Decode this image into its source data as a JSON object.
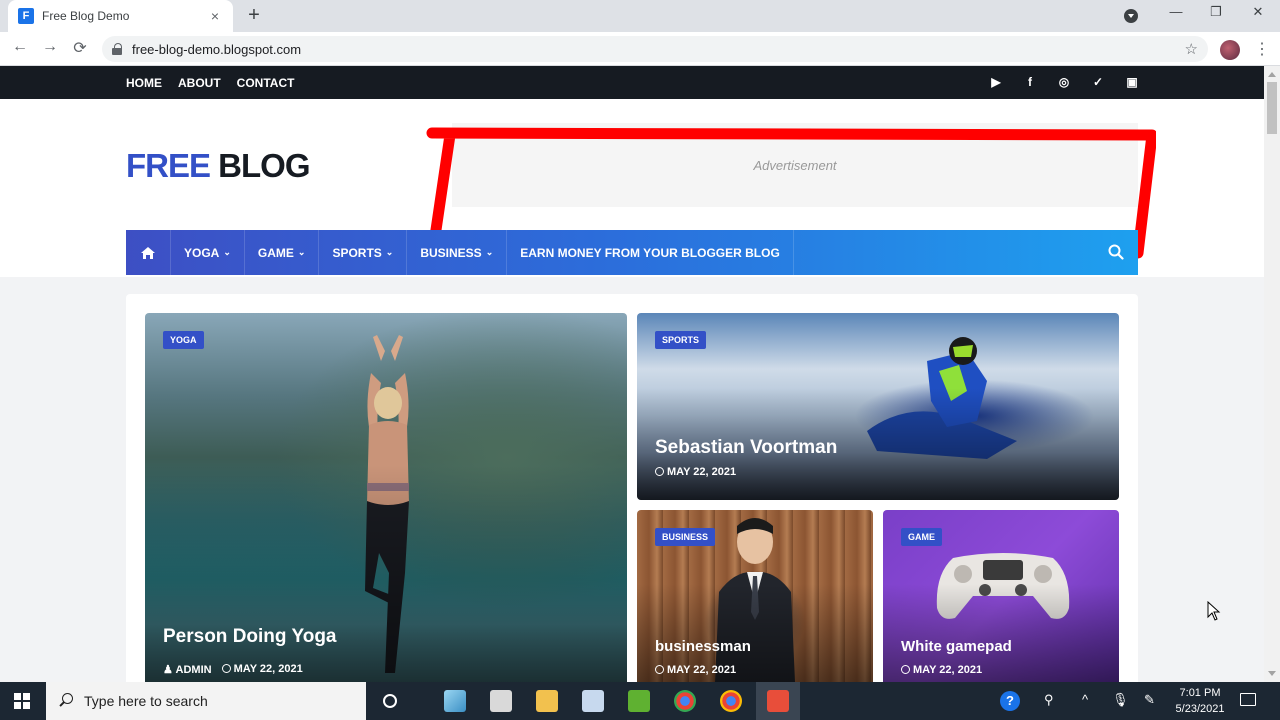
{
  "browser": {
    "tab_title": "Free Blog Demo",
    "tab_favicon_letter": "F",
    "tab_close": "×",
    "new_tab": "+",
    "url": "free-blog-demo.blogspot.com",
    "back": "←",
    "forward": "→",
    "reload": "⟳",
    "star": "☆",
    "menu": "⋮",
    "minimize": "—",
    "maximize": "❐",
    "close": "✕"
  },
  "topbar": {
    "nav": [
      "HOME",
      "ABOUT",
      "CONTACT"
    ],
    "social_icons": [
      "youtube-icon",
      "facebook-icon",
      "instagram-icon",
      "twitter-icon",
      "twitch-icon"
    ],
    "social_glyphs": [
      "▶",
      "f",
      "◎",
      "✓",
      "▣"
    ]
  },
  "header": {
    "logo_part1": "FREE",
    "logo_part2": " BLOG",
    "ad_text": "Advertisement",
    "annotation_color": "#ff0000"
  },
  "mainnav": {
    "items": [
      {
        "label": "YOGA",
        "dropdown": true
      },
      {
        "label": "GAME",
        "dropdown": true
      },
      {
        "label": "SPORTS",
        "dropdown": true
      },
      {
        "label": "BUSINESS",
        "dropdown": true
      },
      {
        "label": "EARN MONEY FROM YOUR BLOGGER BLOG",
        "dropdown": false
      }
    ],
    "caret": "⌄",
    "colors": {
      "start": "#3d4fc4",
      "end": "#1ea0ef"
    }
  },
  "posts": [
    {
      "category": "YOGA",
      "title": "Person Doing Yoga",
      "author": "ADMIN",
      "date": "MAY 22, 2021"
    },
    {
      "category": "SPORTS",
      "title": "Sebastian Voortman",
      "date": "MAY 22, 2021"
    },
    {
      "category": "BUSINESS",
      "title": "businessman",
      "date": "MAY 22, 2021"
    },
    {
      "category": "GAME",
      "title": "White gamepad",
      "date": "MAY 22, 2021"
    }
  ],
  "taskbar": {
    "search_placeholder": "Type here to search",
    "time": "7:01 PM",
    "date": "5/23/2021",
    "caret": "^",
    "help": "?"
  },
  "theme": {
    "accent": "#3350c7",
    "dark": "#161b22"
  }
}
